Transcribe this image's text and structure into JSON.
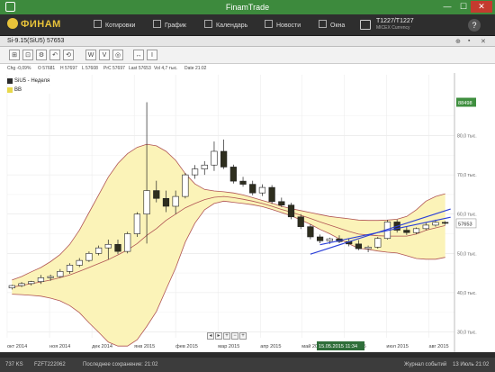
{
  "window": {
    "title": "FinamTrade",
    "minimize": "—",
    "maximize": "☐",
    "close": "✕"
  },
  "nav": {
    "logo": "ФИНАМ",
    "items": [
      {
        "label": "Котировки",
        "icon": "quotes-icon"
      },
      {
        "label": "График",
        "icon": "chart-icon"
      },
      {
        "label": "Календарь",
        "icon": "calendar-icon"
      },
      {
        "label": "Новости",
        "icon": "news-icon"
      },
      {
        "label": "Окна",
        "icon": "windows-icon"
      }
    ],
    "account": {
      "name": "T1227/T1227",
      "sub": "MICEX Currency"
    },
    "help": "?"
  },
  "panel": {
    "title": "Si-9.15(SiU5) 57653",
    "controls": [
      "⊕",
      "▪",
      "✕"
    ]
  },
  "toolbar": {
    "buttons": [
      "⊞",
      "⊡",
      "⚙",
      "↶",
      "⟲",
      "W",
      "V",
      "◎",
      "↔",
      "I"
    ]
  },
  "infobar": {
    "chg": "Chg -0,09%",
    "open": "O 57681",
    "high": "H 57697",
    "low": "L 57608",
    "prev_close": "PrC 57697",
    "last": "Last 57653",
    "vol": "Vol 4,7 тыс.",
    "date": "Date 21:02"
  },
  "legend": [
    {
      "label": "SiU5 - Неделя",
      "color": "#2b2b2b"
    },
    {
      "label": "BB",
      "color": "#e8d84a"
    }
  ],
  "chart_data": {
    "type": "candlestick",
    "timeframe": "week",
    "x_ticks": [
      "окт 2014",
      "ноя 2014",
      "дек 2014",
      "янв 2015",
      "фев 2015",
      "мар 2015",
      "апр 2015",
      "май 2015",
      "июн 2015",
      "июл 2015",
      "авг 2015"
    ],
    "y_ticks": [
      "30,0 тыс.",
      "40,0 тыс.",
      "50,0 тыс.",
      "60,0 тыс.",
      "70,0 тыс.",
      "80,0 тыс."
    ],
    "ylim": [
      28500,
      95500
    ],
    "price_labels": {
      "top": "88498",
      "last": "57653"
    },
    "cursor_label": "15.05.2015 11:34",
    "candles": [
      {
        "o": 41200,
        "h": 42000,
        "l": 40800,
        "c": 41800
      },
      {
        "o": 41800,
        "h": 42700,
        "l": 41400,
        "c": 42300
      },
      {
        "o": 42300,
        "h": 43000,
        "l": 41800,
        "c": 42800
      },
      {
        "o": 42800,
        "h": 44500,
        "l": 42200,
        "c": 43800
      },
      {
        "o": 43800,
        "h": 44600,
        "l": 43000,
        "c": 44100
      },
      {
        "o": 44100,
        "h": 46000,
        "l": 43800,
        "c": 45400
      },
      {
        "o": 45400,
        "h": 47500,
        "l": 44800,
        "c": 47000
      },
      {
        "o": 47000,
        "h": 48800,
        "l": 46500,
        "c": 48200
      },
      {
        "o": 48200,
        "h": 50500,
        "l": 47800,
        "c": 50000
      },
      {
        "o": 50000,
        "h": 52000,
        "l": 49500,
        "c": 51400
      },
      {
        "o": 51400,
        "h": 53500,
        "l": 48500,
        "c": 52300
      },
      {
        "o": 52300,
        "h": 53500,
        "l": 49800,
        "c": 50500
      },
      {
        "o": 50500,
        "h": 55500,
        "l": 50000,
        "c": 55000
      },
      {
        "o": 55000,
        "h": 60500,
        "l": 54200,
        "c": 60000
      },
      {
        "o": 60000,
        "h": 88498,
        "l": 52500,
        "c": 66000
      },
      {
        "o": 66000,
        "h": 68500,
        "l": 63000,
        "c": 64000
      },
      {
        "o": 64000,
        "h": 66000,
        "l": 60500,
        "c": 62000
      },
      {
        "o": 62000,
        "h": 66000,
        "l": 60000,
        "c": 64500
      },
      {
        "o": 64500,
        "h": 70500,
        "l": 64000,
        "c": 70000
      },
      {
        "o": 70000,
        "h": 72500,
        "l": 69000,
        "c": 71500
      },
      {
        "o": 71500,
        "h": 73500,
        "l": 70000,
        "c": 72500
      },
      {
        "o": 72500,
        "h": 78500,
        "l": 71000,
        "c": 76000
      },
      {
        "o": 76000,
        "h": 79000,
        "l": 71500,
        "c": 72000
      },
      {
        "o": 72000,
        "h": 72600,
        "l": 67800,
        "c": 68400
      },
      {
        "o": 68400,
        "h": 69500,
        "l": 67000,
        "c": 67600
      },
      {
        "o": 67600,
        "h": 68500,
        "l": 64800,
        "c": 65400
      },
      {
        "o": 65400,
        "h": 67600,
        "l": 64600,
        "c": 66800
      },
      {
        "o": 66800,
        "h": 67400,
        "l": 62600,
        "c": 63200
      },
      {
        "o": 63200,
        "h": 64200,
        "l": 61800,
        "c": 62300
      },
      {
        "o": 62300,
        "h": 62900,
        "l": 58700,
        "c": 59300
      },
      {
        "o": 59300,
        "h": 60000,
        "l": 56200,
        "c": 56800
      },
      {
        "o": 56800,
        "h": 57400,
        "l": 53600,
        "c": 54200
      },
      {
        "o": 54200,
        "h": 54800,
        "l": 52600,
        "c": 53200
      },
      {
        "o": 53200,
        "h": 54000,
        "l": 52400,
        "c": 53700
      },
      {
        "o": 53700,
        "h": 54600,
        "l": 52600,
        "c": 53000
      },
      {
        "o": 53000,
        "h": 53800,
        "l": 51800,
        "c": 52400
      },
      {
        "o": 52400,
        "h": 53400,
        "l": 50800,
        "c": 51200
      },
      {
        "o": 51200,
        "h": 52000,
        "l": 50300,
        "c": 51600
      },
      {
        "o": 51600,
        "h": 54200,
        "l": 51200,
        "c": 53800
      },
      {
        "o": 53800,
        "h": 58500,
        "l": 53500,
        "c": 58000
      },
      {
        "o": 58000,
        "h": 58600,
        "l": 55300,
        "c": 55900
      },
      {
        "o": 55900,
        "h": 56800,
        "l": 54700,
        "c": 55300
      },
      {
        "o": 55300,
        "h": 56600,
        "l": 54900,
        "c": 56300
      },
      {
        "o": 56300,
        "h": 57800,
        "l": 55900,
        "c": 57200
      },
      {
        "o": 57200,
        "h": 58600,
        "l": 56800,
        "c": 57900
      },
      {
        "o": 57900,
        "h": 58200,
        "l": 57300,
        "c": 57653
      }
    ],
    "bb_upper": [
      43200,
      44100,
      45300,
      46400,
      47900,
      49700,
      52300,
      55900,
      60400,
      64900,
      69400,
      72900,
      75400,
      77000,
      77800,
      77400,
      76000,
      73700,
      70300,
      67700,
      66300,
      65900,
      65700,
      65400,
      64900,
      64200,
      63500,
      62800,
      62000,
      61400,
      60900,
      60400,
      59900,
      59400,
      59100,
      58800,
      58500,
      58400,
      58400,
      58500,
      58700,
      59400,
      61100,
      63300,
      64500,
      65200
    ],
    "bb_middle": [
      41400,
      41800,
      42300,
      42700,
      43200,
      43800,
      44500,
      45400,
      46400,
      47400,
      48400,
      49600,
      50900,
      52500,
      54600,
      56300,
      58400,
      60000,
      61600,
      62700,
      63700,
      64300,
      64500,
      64200,
      63800,
      63300,
      62700,
      62000,
      61200,
      60500,
      59700,
      58900,
      58000,
      57200,
      56400,
      55600,
      54900,
      54700,
      54500,
      54400,
      54400,
      54400,
      54900,
      55900,
      56500,
      57100
    ],
    "bb_lower": [
      39600,
      39500,
      39300,
      39100,
      38600,
      37900,
      36700,
      34900,
      32300,
      29900,
      27400,
      26400,
      26400,
      28000,
      31400,
      35200,
      40800,
      46300,
      52900,
      57700,
      61100,
      62700,
      63300,
      63000,
      62700,
      62400,
      61900,
      61200,
      60400,
      59600,
      58500,
      57400,
      56100,
      55000,
      53700,
      52400,
      51300,
      51000,
      50600,
      50300,
      50100,
      49400,
      48700,
      48500,
      48500,
      49000
    ],
    "trendlines": [
      {
        "from": [
          31,
          49800
        ],
        "to": [
          45,
          61000
        ]
      },
      {
        "from": [
          32,
          52200
        ],
        "to": [
          45,
          58900
        ]
      }
    ]
  },
  "status": {
    "ks": "737 KS",
    "id": "FZFT222062",
    "saved": "Последнее сохранение: 21:02",
    "journal": "Журнал событий",
    "datetime": "13 Июль 21:02"
  }
}
